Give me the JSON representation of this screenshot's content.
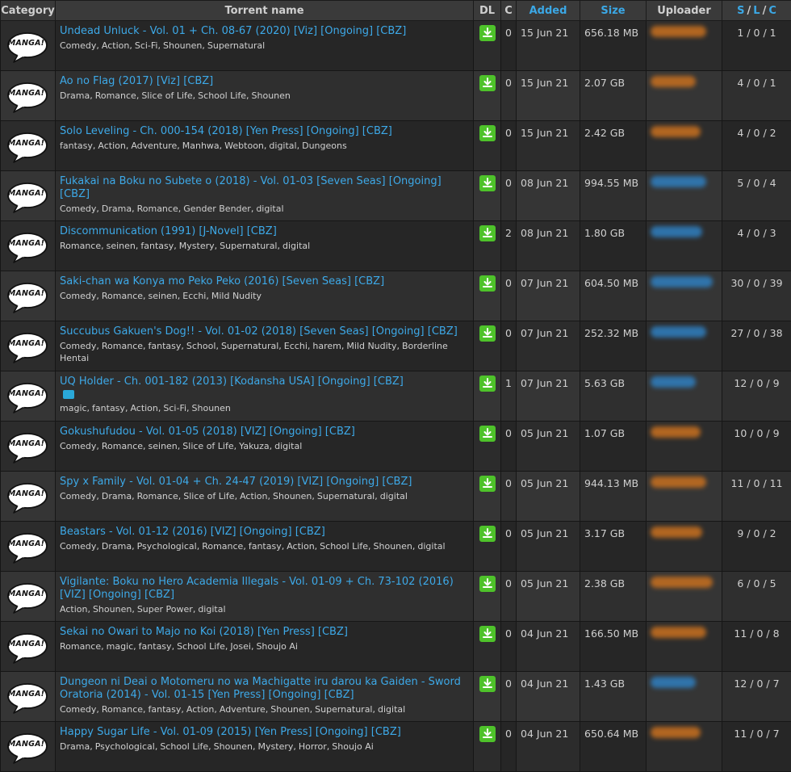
{
  "columns": {
    "category": "Category",
    "name": "Torrent name",
    "dl": "DL",
    "c": "C",
    "added": "Added",
    "size": "Size",
    "uploader": "Uploader",
    "s": "S",
    "l": "L",
    "c2": "C"
  },
  "category_icon_text": "MANGA!",
  "colors": {
    "link": "#3da9e8",
    "uploader_orange": "#c8701f",
    "uploader_blue": "#2f7fc0",
    "download": "#4ec22a"
  },
  "rows": [
    {
      "name": "Undead Unluck - Vol. 01 + Ch. 08-67 (2020) [Viz] [Ongoing] [CBZ]",
      "tags": [
        "Comedy",
        "Action",
        "Sci-Fi",
        "Shounen",
        "Supernatural"
      ],
      "comments": "0",
      "added": "15 Jun 21",
      "size": "656.18 MB",
      "uploader_color": "orange",
      "slc": "1 / 0 / 1"
    },
    {
      "name": "Ao no Flag (2017) [Viz] [CBZ]",
      "tags": [
        "Drama",
        "Romance",
        "Slice of Life",
        "School Life",
        "Shounen"
      ],
      "comments": "0",
      "added": "15 Jun 21",
      "size": "2.07 GB",
      "uploader_color": "orange",
      "slc": "4 / 0 / 1"
    },
    {
      "name": "Solo Leveling - Ch. 000-154 (2018) [Yen Press] [Ongoing] [CBZ]",
      "tags": [
        "fantasy",
        "Action",
        "Adventure",
        "Manhwa",
        "Webtoon",
        "digital",
        "Dungeons"
      ],
      "comments": "0",
      "added": "15 Jun 21",
      "size": "2.42 GB",
      "uploader_color": "orange",
      "slc": "4 / 0 / 2"
    },
    {
      "name": "Fukakai na Boku no Subete o (2018) - Vol. 01-03 [Seven Seas] [Ongoing] [CBZ]",
      "tags": [
        "Comedy",
        "Drama",
        "Romance",
        "Gender Bender",
        "digital"
      ],
      "comments": "0",
      "added": "08 Jun 21",
      "size": "994.55 MB",
      "uploader_color": "blue",
      "slc": "5 / 0 / 4"
    },
    {
      "name": "Discommunication (1991) [J-Novel] [CBZ]",
      "tags": [
        "Romance",
        "seinen",
        "fantasy",
        "Mystery",
        "Supernatural",
        "digital"
      ],
      "comments": "2",
      "added": "08 Jun 21",
      "size": "1.80 GB",
      "uploader_color": "blue",
      "slc": "4 / 0 / 3"
    },
    {
      "name": "Saki-chan wa Konya mo Peko Peko (2016) [Seven Seas] [CBZ]",
      "tags": [
        "Comedy",
        "Romance",
        "seinen",
        "Ecchi",
        "Mild Nudity"
      ],
      "comments": "0",
      "added": "07 Jun 21",
      "size": "604.50 MB",
      "uploader_color": "blue",
      "slc": "30 / 0 / 39"
    },
    {
      "name": "Succubus Gakuen's Dog!! - Vol. 01-02 (2018) [Seven Seas] [Ongoing] [CBZ]",
      "tags": [
        "Comedy",
        "Romance",
        "fantasy",
        "School",
        "Supernatural",
        "Ecchi",
        "harem",
        "Mild Nudity",
        "Borderline Hentai"
      ],
      "comments": "0",
      "added": "07 Jun 21",
      "size": "252.32 MB",
      "uploader_color": "blue",
      "slc": "27 / 0 / 38"
    },
    {
      "name": "UQ Holder - Ch. 001-182 (2013) [Kodansha USA] [Ongoing] [CBZ]",
      "tags": [
        "magic",
        "fantasy",
        "Action",
        "Sci-Fi",
        "Shounen"
      ],
      "comments": "1",
      "added": "07 Jun 21",
      "size": "5.63 GB",
      "uploader_color": "blue",
      "slc": "12 / 0 / 9",
      "extra_icon": "info-icon"
    },
    {
      "name": "Gokushufudou - Vol. 01-05 (2018) [VIZ] [Ongoing] [CBZ]",
      "tags": [
        "Comedy",
        "Romance",
        "seinen",
        "Slice of Life",
        "Yakuza",
        "digital"
      ],
      "comments": "0",
      "added": "05 Jun 21",
      "size": "1.07 GB",
      "uploader_color": "orange",
      "slc": "10 / 0 / 9"
    },
    {
      "name": "Spy x Family - Vol. 01-04 + Ch. 24-47 (2019) [VIZ] [Ongoing] [CBZ]",
      "tags": [
        "Comedy",
        "Drama",
        "Romance",
        "Slice of Life",
        "Action",
        "Shounen",
        "Supernatural",
        "digital"
      ],
      "comments": "0",
      "added": "05 Jun 21",
      "size": "944.13 MB",
      "uploader_color": "orange",
      "slc": "11 / 0 / 11"
    },
    {
      "name": "Beastars - Vol. 01-12 (2016) [VIZ] [Ongoing] [CBZ]",
      "tags": [
        "Comedy",
        "Drama",
        "Psychological",
        "Romance",
        "fantasy",
        "Action",
        "School Life",
        "Shounen",
        "digital"
      ],
      "comments": "0",
      "added": "05 Jun 21",
      "size": "3.17 GB",
      "uploader_color": "orange",
      "slc": "9 / 0 / 2"
    },
    {
      "name": "Vigilante: Boku no Hero Academia Illegals - Vol. 01-09 + Ch. 73-102 (2016) [VIZ] [Ongoing] [CBZ]",
      "tags": [
        "Action",
        "Shounen",
        "Super Power",
        "digital"
      ],
      "comments": "0",
      "added": "05 Jun 21",
      "size": "2.38 GB",
      "uploader_color": "orange",
      "slc": "6 / 0 / 5"
    },
    {
      "name": "Sekai no Owari to Majo no Koi (2018) [Yen Press] [CBZ]",
      "tags": [
        "Romance",
        "magic",
        "fantasy",
        "School Life",
        "Josei",
        "Shoujo Ai"
      ],
      "comments": "0",
      "added": "04 Jun 21",
      "size": "166.50 MB",
      "uploader_color": "orange",
      "slc": "11 / 0 / 8"
    },
    {
      "name": "Dungeon ni Deai o Motomeru no wa Machigatte iru darou ka Gaiden - Sword Oratoria (2014) - Vol. 01-15 [Yen Press] [Ongoing] [CBZ]",
      "tags": [
        "Comedy",
        "Romance",
        "fantasy",
        "Action",
        "Adventure",
        "Shounen",
        "Supernatural",
        "digital"
      ],
      "comments": "0",
      "added": "04 Jun 21",
      "size": "1.43 GB",
      "uploader_color": "blue",
      "slc": "12 / 0 / 7"
    },
    {
      "name": "Happy Sugar Life - Vol. 01-09 (2015) [Yen Press] [Ongoing] [CBZ]",
      "tags": [
        "Drama",
        "Psychological",
        "School Life",
        "Shounen",
        "Mystery",
        "Horror",
        "Shoujo Ai"
      ],
      "comments": "0",
      "added": "04 Jun 21",
      "size": "650.64 MB",
      "uploader_color": "orange",
      "slc": "11 / 0 / 7"
    }
  ]
}
